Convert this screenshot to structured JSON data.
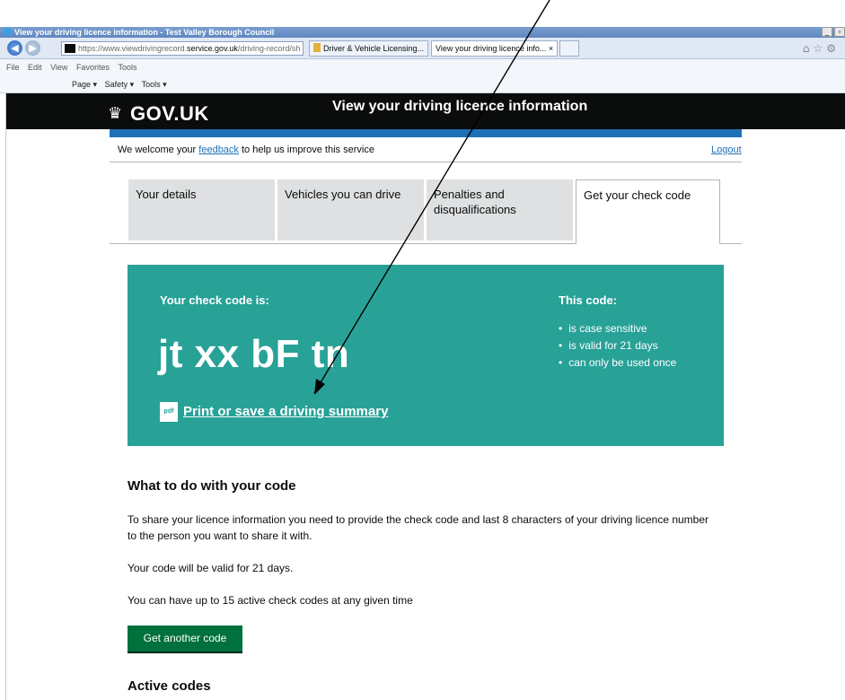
{
  "browser": {
    "window_title": "View your driving licence information - Test Valley Borough Council",
    "address_prefix": "https://www.viewdrivingrecord.",
    "address_domain": "service.gov.uk",
    "address_path": "/driving-record/sh",
    "tabs": [
      {
        "label": "Driver & Vehicle Licensing..."
      },
      {
        "label": "View your driving licence info...   ×"
      }
    ],
    "menu": [
      "File",
      "Edit",
      "View",
      "Favorites",
      "Tools"
    ],
    "commands": [
      "Page ▾",
      "Safety ▾",
      "Tools ▾"
    ]
  },
  "header": {
    "logo": "GOV.UK",
    "service_name": "View your driving licence information"
  },
  "feedback": {
    "before": "We welcome your ",
    "link": "feedback",
    "after": " to help us improve this service",
    "logout": "Logout"
  },
  "tabs": [
    {
      "label": "Your details"
    },
    {
      "label": "Vehicles you can drive"
    },
    {
      "label": "Penalties and disqualifications"
    },
    {
      "label": "Get your check code"
    }
  ],
  "check_code": {
    "label": "Your check code is:",
    "code": "jt xx bF tn",
    "pdf_icon": "pdf",
    "print_link": "Print or save a driving summary",
    "this_code_label": "This code:",
    "bullets": [
      "is case sensitive",
      "is valid for 21 days",
      "can only be used once"
    ]
  },
  "what_to_do": {
    "heading": "What to do with your code",
    "para1": "To share your licence information you need to provide the check code and last 8 characters of your driving licence number to the person you want to share it with.",
    "para2": "Your code will be valid for 21 days.",
    "para3": "You can have up to 15 active check codes at any given time",
    "button": "Get another code"
  },
  "active_codes": {
    "heading": "Active codes"
  },
  "colors": {
    "panel": "#28a197",
    "header": "#0b0c0c",
    "link": "#1d70b8",
    "button": "#00703c"
  }
}
